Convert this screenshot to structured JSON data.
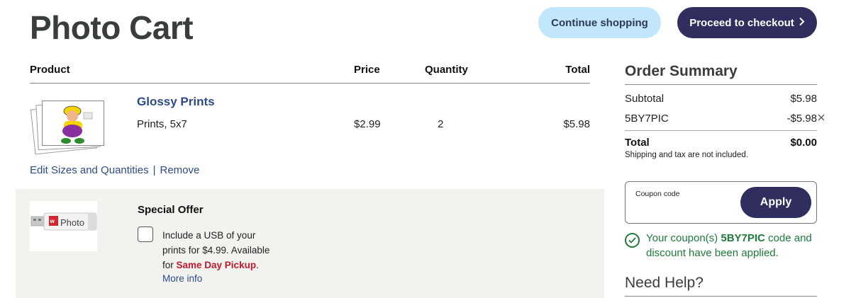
{
  "header": {
    "title": "Photo Cart",
    "continue_label": "Continue shopping",
    "checkout_label": "Proceed to checkout",
    "checkout_icon": "chevron-right-icon"
  },
  "table": {
    "columns": [
      "Product",
      "Price",
      "Quantity",
      "Total"
    ]
  },
  "cart_item": {
    "name": "Glossy Prints",
    "variant": "Prints, 5x7",
    "price": "$2.99",
    "quantity": "2",
    "total": "$5.98",
    "edit_label": "Edit Sizes and Quantities",
    "separator": "|",
    "remove_label": "Remove"
  },
  "special_offer": {
    "title": "Special Offer",
    "usb_brand": "Photo",
    "text_before": "Include a USB of your prints for $4.99. Available for ",
    "highlight": "Same Day Pickup",
    "text_after": ".",
    "more_info_label": "More info",
    "checked": false
  },
  "summary": {
    "title": "Order Summary",
    "subtotal_label": "Subtotal",
    "subtotal_value": "$5.98",
    "coupon_code": "5BY7PIC",
    "coupon_discount": "-$5.98",
    "remove_icon": "close-icon",
    "total_label": "Total",
    "total_value": "$0.00",
    "note": "Shipping and tax are not included."
  },
  "coupon": {
    "label": "Coupon code",
    "value": "",
    "apply_label": "Apply"
  },
  "coupon_message": {
    "before": "Your coupon(s) ",
    "code": "5BY7PIC",
    "after": " code and discount have been applied.",
    "icon": "check-circle-icon"
  },
  "help": {
    "title": "Need Help?"
  },
  "colors": {
    "brand_navy": "#302e5e",
    "light_blue": "#c2e6fb",
    "link_blue": "#2d4b86",
    "success_green": "#1e7a3c",
    "offer_red": "#c01b2c",
    "offer_bg": "#f2f2ee"
  }
}
